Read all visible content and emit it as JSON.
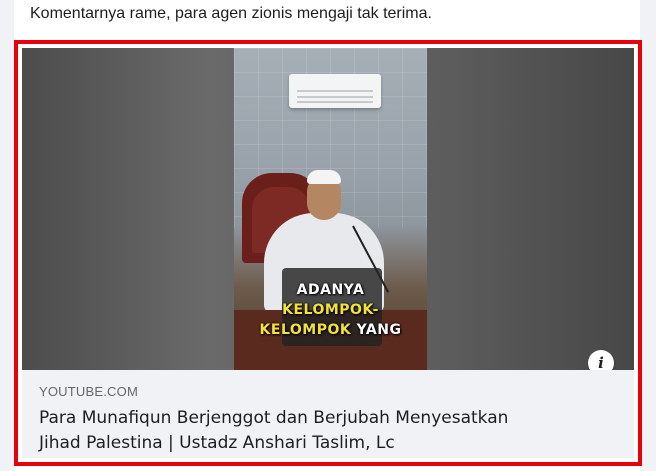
{
  "post": {
    "text": "Komentarnya rame, para agen zionis mengaji tak terima."
  },
  "link_preview": {
    "domain": "YOUTUBE.COM",
    "title_line1": "Para Munafiqun Berjenggot dan Berjubah Menyesatkan",
    "title_line2": "Jihad Palestina | Ustadz Anshari Taslim, Lc",
    "info_button_icon": "info-icon",
    "info_glyph": "i",
    "border_color": "#e8000b"
  },
  "video_caption": {
    "line1": "ADANYA",
    "line2": "KELOMPOK-",
    "line3_yellow": "KELOMPOK",
    "line3_white": " YANG"
  }
}
